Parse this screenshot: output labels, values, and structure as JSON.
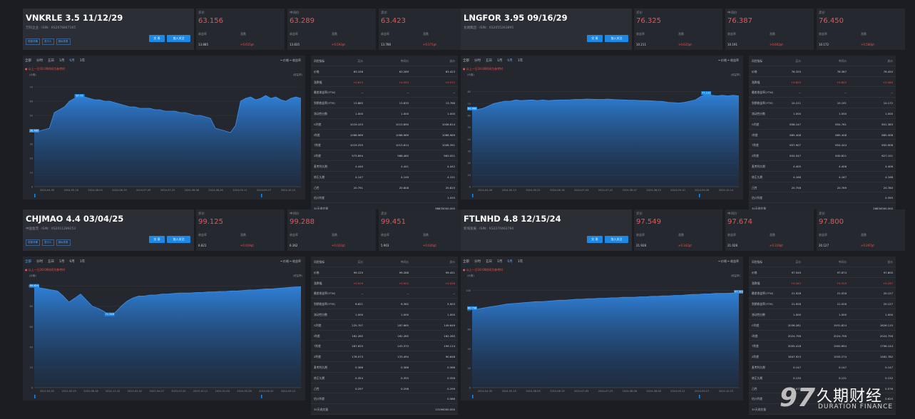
{
  "brand": {
    "logo_glyph": "97",
    "logo_cn": "久期财经",
    "logo_en": "DURATION FINANCE"
  },
  "panels": [
    {
      "bond_name": "VNKRLE 3.5 11/12/29",
      "subtitle": "万科企业 · ISIN：XS2076847165",
      "links": [
        "债券详情",
        "发行人",
        "相似债券"
      ],
      "buttons": {
        "trade": "交 易",
        "watch": "加入关注"
      },
      "quotes": {
        "bid": {
          "label": "买价",
          "value": "63.156",
          "yield_label": "收益率",
          "yield": "13.885",
          "chg_label": "涨跌",
          "chg": "+0.615pt"
        },
        "mid": {
          "label": "中间价",
          "value": "63.289",
          "yield_label": "收益率",
          "yield": "13.835",
          "chg_label": "涨跌",
          "chg": "+0.593pt"
        },
        "ask": {
          "label": "卖价",
          "value": "63.423",
          "yield_label": "收益率",
          "yield": "13.786",
          "chg_label": "涨跌",
          "chg": "+0.571pt"
        }
      },
      "chart": {
        "tabs": [
          "全部",
          "分时",
          "五日",
          "1月",
          "6月",
          "1年"
        ],
        "active_tab": 4,
        "legend": "━ 价格  ━ 收益率",
        "alert": "● 以上一日16:00时间为参考时",
        "unit_left": "(价格)",
        "unit_right": "(收益率)",
        "yticks": [
          "70",
          "60",
          "50",
          "40",
          "30",
          "20",
          "10",
          "0"
        ],
        "xticks": [
          "2024-04-30",
          "2024-05-16",
          "2024-06-03",
          "2024-06-19",
          "2024-07-05",
          "2024-07-23",
          "2024-08-08",
          "2024-08-26",
          "2024-09-11",
          "2024-09-27",
          "2024-10-15"
        ],
        "ymin": 0,
        "ymax": 75,
        "series": [
          38.5,
          39,
          40,
          41,
          52,
          54,
          56,
          60,
          62,
          63,
          63,
          62,
          61,
          61,
          60,
          60,
          59,
          58,
          57,
          56,
          56,
          55,
          55,
          55,
          54,
          54,
          53,
          53,
          53,
          52,
          52,
          51,
          50,
          50,
          49,
          48,
          41,
          40,
          39,
          38,
          43,
          60,
          62,
          63,
          61,
          62,
          64,
          62,
          63,
          61,
          60,
          62,
          63,
          62
        ],
        "marks": [
          {
            "index": 0,
            "label": "38.480"
          },
          {
            "index": 9,
            "label": "67.75"
          }
        ]
      },
      "table": {
        "headers": [
          "风险指标",
          "买价",
          "中间价",
          "卖价"
        ],
        "rows": [
          [
            "价格",
            "63.156",
            "63.289",
            "63.423"
          ],
          [
            "涨跌幅",
            "+0.615",
            "+0.593",
            "+0.571"
          ],
          [
            "最差收益率(YTW)",
            "--",
            "--",
            "--"
          ],
          [
            "到期收益率(YTM)",
            "13.885",
            "13.835",
            "13.786"
          ],
          [
            "流动性分数",
            "1.000",
            "1.000",
            "1.000"
          ],
          [
            "G利差",
            "1019.103",
            "1013.890",
            "1008.614"
          ],
          [
            "I利差",
            "1066.969",
            "1066.969",
            "1066.969"
          ],
          [
            "T利差",
            "1019.255",
            "1013.814",
            "1008.391"
          ],
          [
            "Z利差",
            "973.894",
            "968.465",
            "963.051"
          ],
          [
            "麦考利久期",
            "4.440",
            "4.441",
            "4.442"
          ],
          [
            "修正久期",
            "4.147",
            "4.149",
            "4.151"
          ],
          [
            "凸性",
            "20.791",
            "20.808",
            "20.825"
          ],
          [
            "估计利差",
            "",
            "",
            "1.555"
          ],
          [
            "30天成交量",
            "",
            "",
            "98835000.000"
          ]
        ]
      }
    },
    {
      "bond_name": "LNGFOR 3.95 09/16/29",
      "subtitle": "龙湖集团 · ISIN：XS2055263895",
      "links": [],
      "buttons": {
        "trade": "交 易",
        "watch": "加入关注"
      },
      "quotes": {
        "bid": {
          "label": "买价",
          "value": "76.325",
          "yield_label": "收益率",
          "yield": "10.211",
          "chg_label": "涨跌",
          "chg": "+0.625pt"
        },
        "mid": {
          "label": "中间价",
          "value": "76.387",
          "yield_label": "收益率",
          "yield": "10.191",
          "chg_label": "涨跌",
          "chg": "+0.602pt"
        },
        "ask": {
          "label": "卖价",
          "value": "76.450",
          "yield_label": "收益率",
          "yield": "10.172",
          "chg_label": "涨跌",
          "chg": "+0.580pt"
        }
      },
      "chart": {
        "tabs": [
          "全部",
          "分时",
          "五日",
          "1月",
          "6月",
          "1年"
        ],
        "active_tab": 4,
        "legend": "━ 价格  ━ 收益率",
        "alert": "● 以上一日16:00时间为参考时",
        "unit_left": "(价格)",
        "unit_right": "(收益率)",
        "yticks": [
          "80",
          "70",
          "60",
          "50",
          "40",
          "30",
          "20",
          "10",
          "0"
        ],
        "xticks": [
          "2024-04-26",
          "2024-05-13",
          "2024-05-31",
          "2024-06-18",
          "2024-07-04",
          "2024-07-22",
          "2024-08-07",
          "2024-08-23",
          "2024-09-10",
          "2024-09-26",
          "2024-10-14"
        ],
        "ymin": 0,
        "ymax": 90,
        "series": [
          64.9,
          65,
          66,
          68,
          70,
          71,
          72,
          72,
          73,
          72.5,
          72.8,
          73,
          72.5,
          73,
          72.5,
          72.8,
          73,
          73,
          73.2,
          73.5,
          73.5,
          73.8,
          73.6,
          73.5,
          73.5,
          73.8,
          73.4,
          73.2,
          73,
          72.8,
          72.8,
          72.5,
          72.5,
          72.3,
          72,
          71.8,
          71,
          70.8,
          70.5,
          71,
          72,
          73,
          76,
          78,
          77,
          76.5,
          77,
          76.5,
          77,
          76.4
        ],
        "marks": [
          {
            "index": 0,
            "label": "64.966"
          },
          {
            "index": 43,
            "label": "77.131"
          }
        ]
      },
      "table": {
        "headers": [
          "风险指标",
          "买价",
          "中间价",
          "卖价"
        ],
        "rows": [
          [
            "价格",
            "76.325",
            "76.387",
            "76.450"
          ],
          [
            "涨跌幅",
            "+0.625",
            "+0.602",
            "+0.580"
          ],
          [
            "最差收益率(YTW)",
            "--",
            "--",
            "--"
          ],
          [
            "到期收益率(YTM)",
            "10.211",
            "10.191",
            "10.172"
          ],
          [
            "流动性分数",
            "1.000",
            "1.000",
            "1.000"
          ],
          [
            "G利差",
            "658.147",
            "654.761",
            "651.383"
          ],
          [
            "I利差",
            "685.408",
            "685.408",
            "685.408"
          ],
          [
            "T利差",
            "657.907",
            "654.444",
            "650.908"
          ],
          [
            "Z利差",
            "634.547",
            "630.821",
            "627.101"
          ],
          [
            "麦考利久期",
            "4.405",
            "4.406",
            "4.406"
          ],
          [
            "修正久期",
            "4.166",
            "4.167",
            "4.168"
          ],
          [
            "凸性",
            "20.758",
            "20.769",
            "20.780"
          ],
          [
            "估计利差",
            "",
            "",
            "0.395"
          ],
          [
            "30天成交量",
            "",
            "",
            "26830000.000"
          ]
        ]
      }
    },
    {
      "bond_name": "CHJMAO 4.4 03/04/25",
      "subtitle": "中国金茂 · ISIN：XS2011289253",
      "links": [
        "债券详情",
        "发行人",
        "相似债券"
      ],
      "buttons": {
        "trade": "交 易",
        "watch": "加入关注"
      },
      "quotes": {
        "bid": {
          "label": "买价",
          "value": "99.125",
          "yield_label": "收益率",
          "yield": "6.821",
          "chg_label": "涨跌",
          "chg": "+0.019pt"
        },
        "mid": {
          "label": "中间价",
          "value": "99.288",
          "yield_label": "收益率",
          "yield": "6.362",
          "chg_label": "涨跌",
          "chg": "+0.022pt"
        },
        "ask": {
          "label": "卖价",
          "value": "99.451",
          "yield_label": "收益率",
          "yield": "5.903",
          "chg_label": "涨跌",
          "chg": "+0.026pt"
        }
      },
      "chart": {
        "tabs": [
          "全部",
          "分时",
          "五日",
          "1月",
          "6月",
          "1年"
        ],
        "active_tab": 0,
        "legend": "━ 价格  ━ 收益率",
        "alert": "● 以上一日16:00时间为参考时",
        "unit_left": "(价格)",
        "unit_right": "(收益率)",
        "yticks": [
          "100",
          "80",
          "60",
          "40",
          "20",
          "0"
        ],
        "xticks": [
          "2022-03-02",
          "2022-05-25",
          "2022-08-18",
          "2022-11-10",
          "2023-02-02",
          "2023-04-27",
          "2023-07-20",
          "2023-10-12",
          "2024-01-04",
          "2024-03-28",
          "2024-06-20",
          "2024-09-12"
        ],
        "ymin": 0,
        "ymax": 105,
        "series": [
          99,
          98,
          97,
          96,
          95,
          90,
          84,
          88,
          92,
          86,
          80,
          78,
          75,
          71,
          74,
          80,
          85,
          88,
          90,
          90,
          91,
          91,
          92,
          92,
          92.5,
          93,
          93,
          93,
          93.5,
          93.5,
          94,
          94,
          94.5,
          94.5,
          95,
          95,
          95.5,
          96,
          96,
          96.5,
          97,
          97,
          97.5,
          98,
          98.5,
          99,
          99.1
        ],
        "marks": [
          {
            "index": 0,
            "label": "99.624"
          },
          {
            "index": 13,
            "label": "71.348"
          }
        ]
      },
      "table": {
        "headers": [
          "风险指标",
          "买价",
          "中间价",
          "卖价"
        ],
        "rows": [
          [
            "价格",
            "99.125",
            "99.288",
            "99.451"
          ],
          [
            "涨跌幅",
            "+0.019",
            "+0.022",
            "+0.026"
          ],
          [
            "最差收益率(YTW)",
            "--",
            "--",
            "--"
          ],
          [
            "到期收益率(YTM)",
            "6.821",
            "6.362",
            "5.903"
          ],
          [
            "流动性分数",
            "1.000",
            "1.000",
            "1.000"
          ],
          [
            "G利差",
            "225.707",
            "187.665",
            "149.649"
          ],
          [
            "I利差",
            "162.285",
            "162.285",
            "162.285"
          ],
          [
            "T利差",
            "287.625",
            "243.370",
            "199.114"
          ],
          [
            "Z利差",
            "176.073",
            "133.494",
            "90.848"
          ],
          [
            "麦考利久期",
            "0.366",
            "0.366",
            "0.366"
          ],
          [
            "修正久期",
            "0.354",
            "0.355",
            "0.356"
          ],
          [
            "凸性",
            "0.297",
            "0.298",
            "0.299"
          ],
          [
            "估计利差",
            "",
            "",
            "0.586"
          ],
          [
            "30天成交量",
            "",
            "",
            "13190000.000"
          ]
        ]
      }
    },
    {
      "bond_name": "FTLNHD 4.8 12/15/24",
      "subtitle": "新城发展 · ISIN：XS2270462794",
      "links": [],
      "buttons": {
        "trade": "交 易",
        "watch": "加入关注"
      },
      "quotes": {
        "bid": {
          "label": "买价",
          "value": "97.549",
          "yield_label": "收益率",
          "yield": "21.928",
          "chg_label": "涨跌",
          "chg": "+0.342pt"
        },
        "mid": {
          "label": "中间价",
          "value": "97.674",
          "yield_label": "收益率",
          "yield": "21.028",
          "chg_label": "涨跌",
          "chg": "+0.319pt"
        },
        "ask": {
          "label": "卖价",
          "value": "97.800",
          "yield_label": "收益率",
          "yield": "20.127",
          "chg_label": "涨跌",
          "chg": "+0.297pt"
        }
      },
      "chart": {
        "tabs": [
          "全部",
          "分时",
          "五日",
          "1月",
          "6月",
          "1年"
        ],
        "active_tab": 4,
        "legend": "━ 价格  ━ 收益率",
        "alert": "● 以上一日16:00时间为参考时",
        "unit_left": "(价格)",
        "unit_right": "(收益率)",
        "yticks": [
          "100",
          "80",
          "60",
          "40",
          "20",
          "0"
        ],
        "xticks": [
          "2024-04-30",
          "2024-05-15",
          "2024-06-03",
          "2024-06-19",
          "2024-07-05",
          "2024-07-23",
          "2024-08-08",
          "2024-08-26",
          "2024-09-11",
          "2024-09-27",
          "2024-10-15"
        ],
        "ymin": 0,
        "ymax": 110,
        "series": [
          80.8,
          81,
          82,
          83,
          84,
          85,
          86,
          86.5,
          87,
          87.5,
          88,
          88.5,
          88.5,
          89,
          89.5,
          90,
          90,
          90.5,
          91,
          91,
          91.5,
          91.5,
          92,
          92,
          92.5,
          92.5,
          93,
          93,
          93,
          93.5,
          93.5,
          94,
          94,
          94.5,
          94.5,
          95,
          95,
          95.5,
          96,
          96,
          96.5,
          96.5,
          97,
          97,
          97.2,
          97.4,
          97.5
        ],
        "marks": [
          {
            "index": 0,
            "label": "80.798"
          },
          {
            "index": 46,
            "label": "97.303"
          }
        ]
      },
      "table": {
        "headers": [
          "风险指标",
          "买价",
          "中间价",
          "卖价"
        ],
        "rows": [
          [
            "价格",
            "97.549",
            "97.674",
            "97.800"
          ],
          [
            "涨跌幅",
            "+0.342",
            "+0.319",
            "+0.297"
          ],
          [
            "最差收益率(YTW)",
            "21.928",
            "21.026",
            "20.127"
          ],
          [
            "到期收益率(YTM)",
            "21.928",
            "21.026",
            "20.127"
          ],
          [
            "流动性分数",
            "1.000",
            "1.000",
            "1.000"
          ],
          [
            "G利差",
            "2036.281",
            "1931.824",
            "1826.115"
          ],
          [
            "I利差",
            "2024.756",
            "2024.756",
            "2024.756"
          ],
          [
            "T利差",
            "2005.418",
            "1900.694",
            "1796.144"
          ],
          [
            "Z利差",
            "1647.923",
            "1555.274",
            "1462.782"
          ],
          [
            "麦考利久期",
            "0.147",
            "0.147",
            "0.147"
          ],
          [
            "修正久期",
            "0.130",
            "0.131",
            "0.132"
          ],
          [
            "凸性",
            "0.075",
            "0.076",
            "0.076"
          ],
          [
            "估计利差",
            "",
            "",
            "0.625"
          ],
          [
            "30天成交量",
            "",
            "",
            ""
          ]
        ]
      }
    }
  ]
}
